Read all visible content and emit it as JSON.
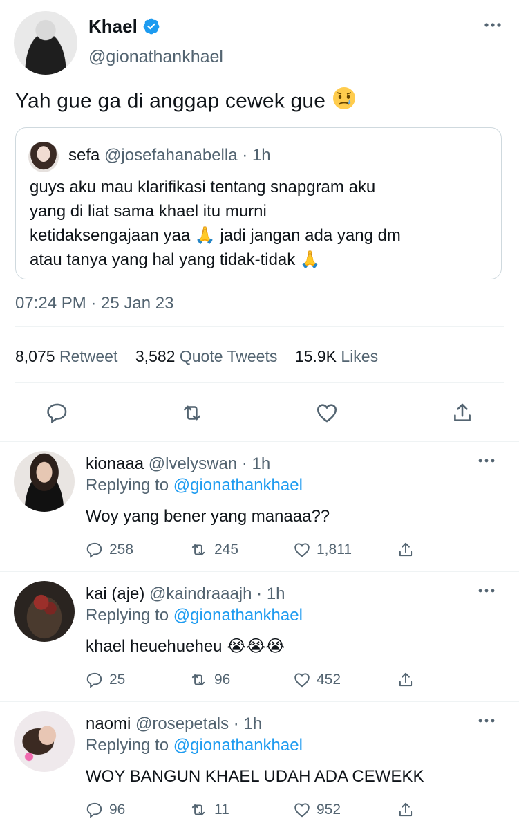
{
  "main_tweet": {
    "name": "Khael",
    "handle": "@gionathankhael",
    "text": "Yah gue ga di anggap cewek gue",
    "text_emoji": "sad-face",
    "quoted": {
      "name": "sefa",
      "handle_time": "@josefahanabella · 1h",
      "lines": [
        "guys aku mau klarifikasi tentang snapgram aku",
        "yang di liat sama khael itu murni",
        "ketidaksengajaan yaa 🙏 jadi jangan ada yang dm",
        "atau tanya yang hal yang tidak-tidak 🙏"
      ]
    },
    "timestamp": "07:24 PM · 25 Jan 23",
    "stats": {
      "retweets": "8,075",
      "retweets_label": "Retweet",
      "quotes": "3,582",
      "quotes_label": "Quote Tweets",
      "likes": "15.9K",
      "likes_label": "Likes"
    }
  },
  "replies": [
    {
      "name": "kionaaa",
      "handle_time": "@lvelyswan · 1h",
      "replying_prefix": "Replying to",
      "replying_to": "@gionathankhael",
      "text": "Woy yang bener yang manaaa??",
      "replies": "258",
      "retweets": "245",
      "likes": "1,811"
    },
    {
      "name": "kai (aje)",
      "handle_time": "@kaindraaajh · 1h",
      "replying_prefix": "Replying to",
      "replying_to": "@gionathankhael",
      "text": "khael heuehueheu 😭😭😭",
      "replies": "25",
      "retweets": "96",
      "likes": "452"
    },
    {
      "name": "naomi",
      "handle_time": "@rosepetals · 1h",
      "replying_prefix": "Replying to",
      "replying_to": "@gionathankhael",
      "text": "WOY BANGUN KHAEL UDAH ADA CEWEKK",
      "replies": "96",
      "retweets": "11",
      "likes": "952"
    }
  ],
  "colors": {
    "accent": "#1d9bf0",
    "secondary_text": "#536471",
    "divider": "#eff3f4"
  }
}
